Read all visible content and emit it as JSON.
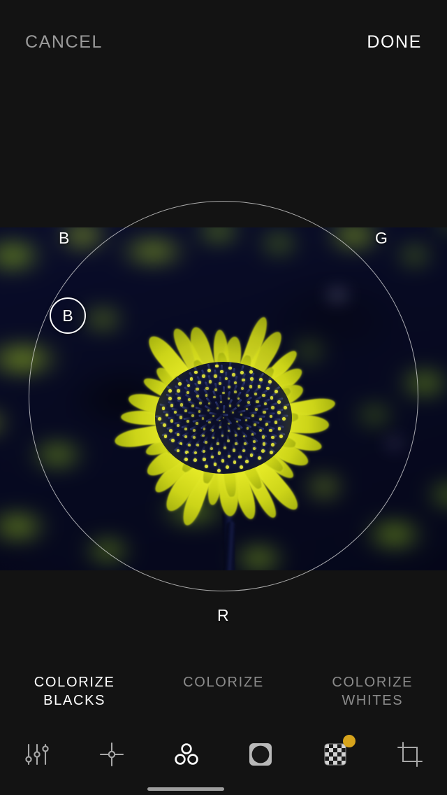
{
  "app": {
    "name": "photo-editor",
    "accent_gold": "#d7a41c",
    "active_text": "#ffffff",
    "inactive_text": "#8b8b8b",
    "background": "#131313"
  },
  "topbar": {
    "cancel_label": "CANCEL",
    "done_label": "DONE"
  },
  "canvas": {
    "photo_description": "close-up of an inverted-color coneflower with bright yellow petals on a dark navy blurred background",
    "color_wheel": {
      "axis_labels": {
        "top_left": "B",
        "top_right": "G",
        "bottom": "R"
      },
      "handle_label": "B",
      "ring_color": "#e8e8e8"
    }
  },
  "modes": [
    {
      "id": "colorize-blacks",
      "line1": "COLORIZE",
      "line2": "BLACKS",
      "state": "active"
    },
    {
      "id": "colorize",
      "line1": "COLORIZE",
      "line2": "",
      "state": "inactive"
    },
    {
      "id": "colorize-whites",
      "line1": "COLORIZE",
      "line2": "WHITES",
      "state": "inactive"
    }
  ],
  "toolbar": [
    {
      "id": "tune",
      "icon": "sliders-icon",
      "state": "inactive",
      "badge": false
    },
    {
      "id": "selective",
      "icon": "crosshair-icon",
      "state": "inactive",
      "badge": false
    },
    {
      "id": "curves",
      "icon": "three-circles-icon",
      "state": "active",
      "badge": false
    },
    {
      "id": "vignette",
      "icon": "vignette-icon",
      "state": "inactive",
      "badge": false
    },
    {
      "id": "grain",
      "icon": "checkerboard-icon",
      "state": "inactive",
      "badge": true
    },
    {
      "id": "crop",
      "icon": "crop-icon",
      "state": "inactive",
      "badge": false
    }
  ]
}
